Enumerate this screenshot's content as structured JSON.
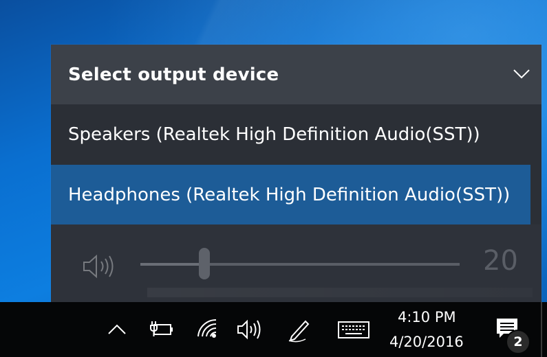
{
  "flyout": {
    "header_title": "Select output device",
    "collapse_icon": "chevron-down-icon",
    "devices": [
      {
        "label": "Speakers (Realtek High Definition Audio(SST))",
        "selected": false
      },
      {
        "label": "Headphones (Realtek High Definition Audio(SST))",
        "selected": true
      }
    ],
    "volume": {
      "icon": "speaker-icon",
      "value": "20",
      "level_fraction": 0.2
    },
    "colors": {
      "header_bg": "#3c4149",
      "panel_bg": "#2b2f36",
      "selected_bg": "#1d5c97"
    }
  },
  "taskbar": {
    "icons": [
      "chevron-up-icon",
      "power-plug-icon",
      "wifi-icon",
      "speaker-icon",
      "pen-icon",
      "keyboard-icon"
    ],
    "clock": {
      "time": "4:10 PM",
      "date": "4/20/2016"
    },
    "notifications": {
      "icon": "action-center-icon",
      "count": "2"
    }
  }
}
